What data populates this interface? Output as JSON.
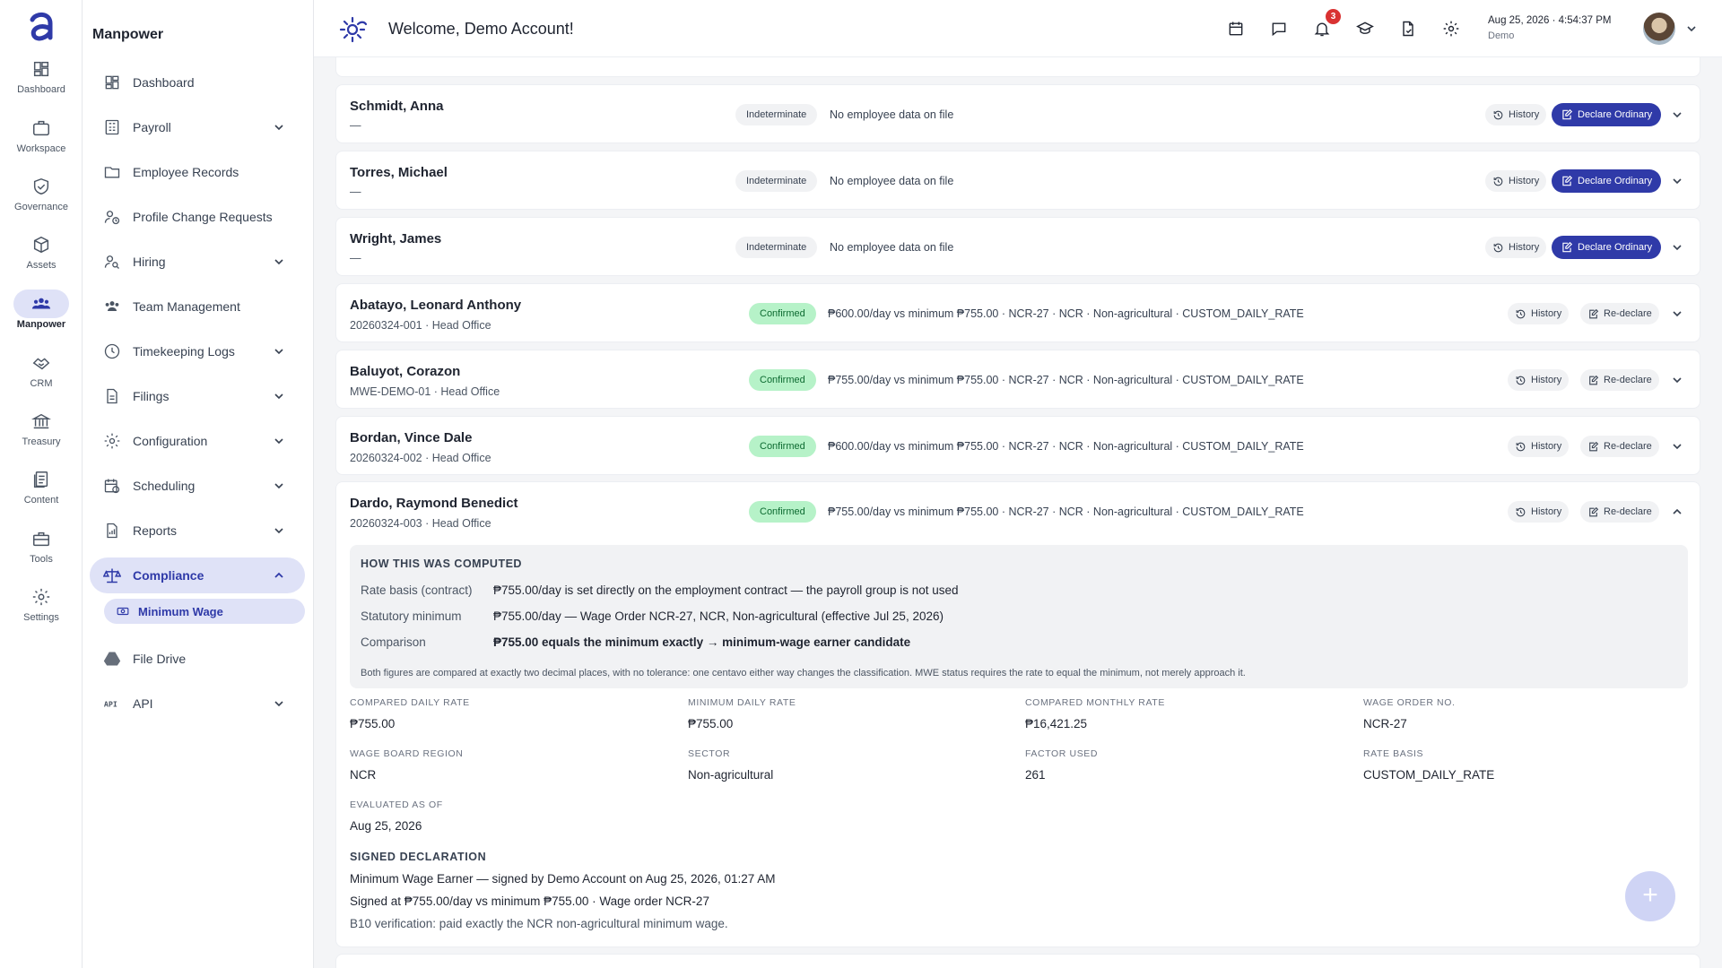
{
  "header": {
    "title": "Welcome, Demo Account!",
    "notif_count": "3",
    "datetime": "Aug 25, 2026 · 4:54:37 PM",
    "user": "Demo",
    "icons": [
      "calendar-icon",
      "chat-icon",
      "bell-icon",
      "graduation-icon",
      "document-icon",
      "gear-icon"
    ]
  },
  "rail": {
    "items": [
      {
        "label": "Dashboard",
        "icon": "grid-icon"
      },
      {
        "label": "Workspace",
        "icon": "briefcase-icon"
      },
      {
        "label": "Governance",
        "icon": "shield-icon"
      },
      {
        "label": "Assets",
        "icon": "box-icon"
      },
      {
        "label": "Manpower",
        "icon": "people-icon"
      },
      {
        "label": "CRM",
        "icon": "handshake-icon"
      },
      {
        "label": "Treasury",
        "icon": "bank-icon"
      },
      {
        "label": "Content",
        "icon": "pages-icon"
      },
      {
        "label": "Tools",
        "icon": "toolbox-icon"
      },
      {
        "label": "Settings",
        "icon": "gear-icon"
      }
    ],
    "active": "Manpower"
  },
  "sidebar": {
    "title": "Manpower",
    "items": [
      {
        "label": "Dashboard",
        "chevron": false
      },
      {
        "label": "Payroll",
        "chevron": true
      },
      {
        "label": "Employee Records",
        "chevron": false
      },
      {
        "label": "Profile Change Requests",
        "chevron": false
      },
      {
        "label": "Hiring",
        "chevron": true
      },
      {
        "label": "Team Management",
        "chevron": false
      },
      {
        "label": "Timekeeping Logs",
        "chevron": true
      },
      {
        "label": "Filings",
        "chevron": true
      },
      {
        "label": "Configuration",
        "chevron": true
      },
      {
        "label": "Scheduling",
        "chevron": true
      },
      {
        "label": "Reports",
        "chevron": true
      },
      {
        "label": "Compliance",
        "chevron": true
      },
      {
        "label": "File Drive",
        "chevron": false
      },
      {
        "label": "API",
        "chevron": true
      }
    ],
    "sub_item": "Minimum Wage"
  },
  "rows": [
    {
      "name": "Schmidt, Anna",
      "sub": "—",
      "status": "Indeterminate",
      "detail": "No employee data on file",
      "history": "History",
      "action": "Declare Ordinary"
    },
    {
      "name": "Torres, Michael",
      "sub": "—",
      "status": "Indeterminate",
      "detail": "No employee data on file",
      "history": "History",
      "action": "Declare Ordinary"
    },
    {
      "name": "Wright, James",
      "sub": "—",
      "status": "Indeterminate",
      "detail": "No employee data on file",
      "history": "History",
      "action": "Declare Ordinary"
    },
    {
      "name": "Abatayo, Leonard Anthony",
      "sub": "20260324-001 · Head Office",
      "status": "Confirmed",
      "detail": "₱600.00/day vs minimum ₱755.00 · NCR-27 · NCR · Non-agricultural · CUSTOM_DAILY_RATE",
      "history": "History",
      "action": "Re-declare"
    },
    {
      "name": "Baluyot, Corazon",
      "sub": "MWE-DEMO-01 · Head Office",
      "status": "Confirmed",
      "detail": "₱755.00/day vs minimum ₱755.00 · NCR-27 · NCR · Non-agricultural · CUSTOM_DAILY_RATE",
      "history": "History",
      "action": "Re-declare"
    },
    {
      "name": "Bordan, Vince Dale",
      "sub": "20260324-002 · Head Office",
      "status": "Confirmed",
      "detail": "₱600.00/day vs minimum ₱755.00 · NCR-27 · NCR · Non-agricultural · CUSTOM_DAILY_RATE",
      "history": "History",
      "action": "Re-declare"
    }
  ],
  "expanded": {
    "name": "Dardo, Raymond Benedict",
    "sub": "20260324-003 · Head Office",
    "status": "Confirmed",
    "detail": "₱755.00/day vs minimum ₱755.00 · NCR-27 · NCR · Non-agricultural · CUSTOM_DAILY_RATE",
    "history": "History",
    "action": "Re-declare",
    "computed": {
      "heading": "HOW THIS WAS COMPUTED",
      "rate_basis_label": "Rate basis (contract)",
      "rate_basis_value": "₱755.00/day is set directly on the employment contract — the payroll group is not used",
      "statutory_label": "Statutory minimum",
      "statutory_value": "₱755.00/day — Wage Order NCR-27, NCR, Non-agricultural (effective Jul 25, 2026)",
      "comparison_label": "Comparison",
      "comparison_value": "₱755.00 equals the minimum exactly → minimum-wage earner candidate",
      "note": "Both figures are compared at exactly two decimal places, with no tolerance: one centavo either way changes the classification. MWE status requires the rate to equal the minimum, not merely approach it."
    },
    "fields": [
      {
        "label": "COMPARED DAILY RATE",
        "value": "₱755.00"
      },
      {
        "label": "MINIMUM DAILY RATE",
        "value": "₱755.00"
      },
      {
        "label": "COMPARED MONTHLY RATE",
        "value": "₱16,421.25"
      },
      {
        "label": "WAGE ORDER NO.",
        "value": "NCR-27"
      },
      {
        "label": "WAGE BOARD REGION",
        "value": "NCR"
      },
      {
        "label": "SECTOR",
        "value": "Non-agricultural"
      },
      {
        "label": "FACTOR USED",
        "value": "261"
      },
      {
        "label": "RATE BASIS",
        "value": "CUSTOM_DAILY_RATE"
      },
      {
        "label": "EVALUATED AS OF",
        "value": "Aug 25, 2026"
      }
    ],
    "signed": {
      "heading": "SIGNED DECLARATION",
      "line1": "Minimum Wage Earner — signed by Demo Account on Aug 25, 2026, 01:27 AM",
      "line2": "Signed at ₱755.00/day vs minimum ₱755.00 · Wage order NCR-27",
      "line3": "B10 verification: paid exactly the NCR non-agricultural minimum wage."
    }
  },
  "colors": {
    "primary": "#2f3aa8",
    "confirmed_bg": "#b6f2c8",
    "confirmed_text": "#0d6b31",
    "active_bg": "#dfe2f7",
    "badge": "#d93232"
  }
}
